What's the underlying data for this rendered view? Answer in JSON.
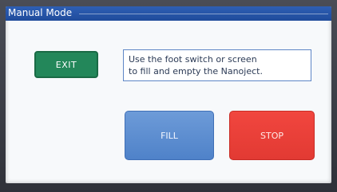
{
  "window": {
    "title": "Manual Mode"
  },
  "buttons": {
    "exit_label": "EXIT",
    "fill_label": "FILL",
    "stop_label": "STOP"
  },
  "message": {
    "text": "Use the foot switch or screen\nto fill and empty the Nanoject."
  },
  "colors": {
    "title_bar": "#2e5fb4",
    "exit_button": "#23875a",
    "fill_button": "#5b8ed2",
    "stop_button": "#ea3f38",
    "screen_background": "#f7f9fb"
  }
}
